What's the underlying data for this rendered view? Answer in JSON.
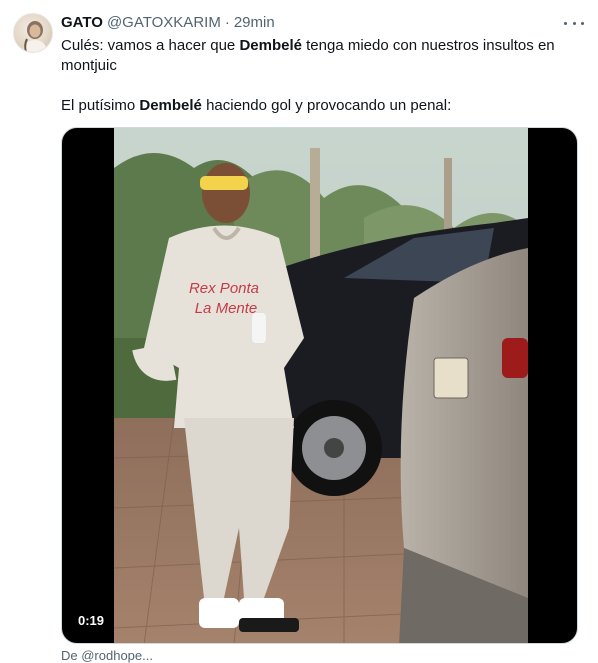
{
  "tweet": {
    "author_name": "GATO",
    "handle": "@GATOXKARIM",
    "separator": "·",
    "time": "29min",
    "text_line1_prefix": "Culés: vamos a hacer que ",
    "text_line1_bold": "Dembelé",
    "text_line1_suffix": " tenga miedo con nuestros insultos en",
    "text_line2": "montjuic",
    "text_line3_prefix": "El putísimo ",
    "text_line3_bold": "Dembelé",
    "text_line3_suffix": " haciendo gol y provocando un penal:",
    "more_icon": "more-horizontal-icon"
  },
  "media": {
    "duration": "0:19",
    "hoodie_text_1": "Rex Ponta",
    "hoodie_text_2": "La Mente",
    "below_text": "De @rodhope..."
  }
}
